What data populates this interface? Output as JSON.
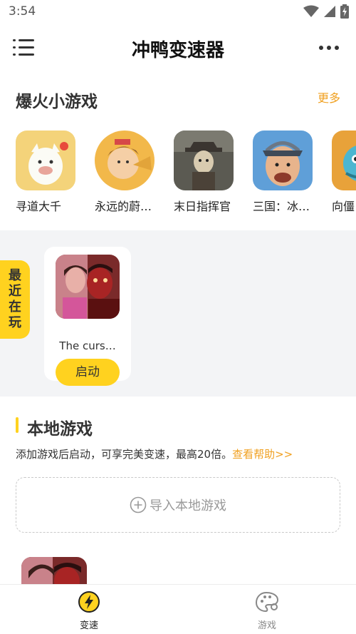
{
  "status_bar": {
    "time": "3:54"
  },
  "header": {
    "title": "冲鸭变速器"
  },
  "hot_games": {
    "title": "爆火小游戏",
    "more_label": "更多",
    "items": [
      {
        "name": "寻道大千"
      },
      {
        "name": "永远的蔚…"
      },
      {
        "name": "末日指挥官"
      },
      {
        "name": "三国：冰…"
      },
      {
        "name": "向僵"
      }
    ]
  },
  "recent": {
    "tab_label": [
      "最",
      "近",
      "在",
      "玩"
    ],
    "game_name": "The curs…",
    "start_label": "启动"
  },
  "local_games": {
    "title": "本地游戏",
    "description": "添加游戏后启动，可享完美变速，最高20倍。",
    "help_link": "查看帮助>>",
    "import_label": "导入本地游戏"
  },
  "bottom_nav": {
    "items": [
      {
        "label": "变速",
        "icon": "lightning-icon",
        "active": true
      },
      {
        "label": "游戏",
        "icon": "palette-icon",
        "active": false
      }
    ]
  },
  "colors": {
    "accent": "#ffd21f",
    "link": "#f0a020",
    "section_bg": "#f3f4f6"
  }
}
